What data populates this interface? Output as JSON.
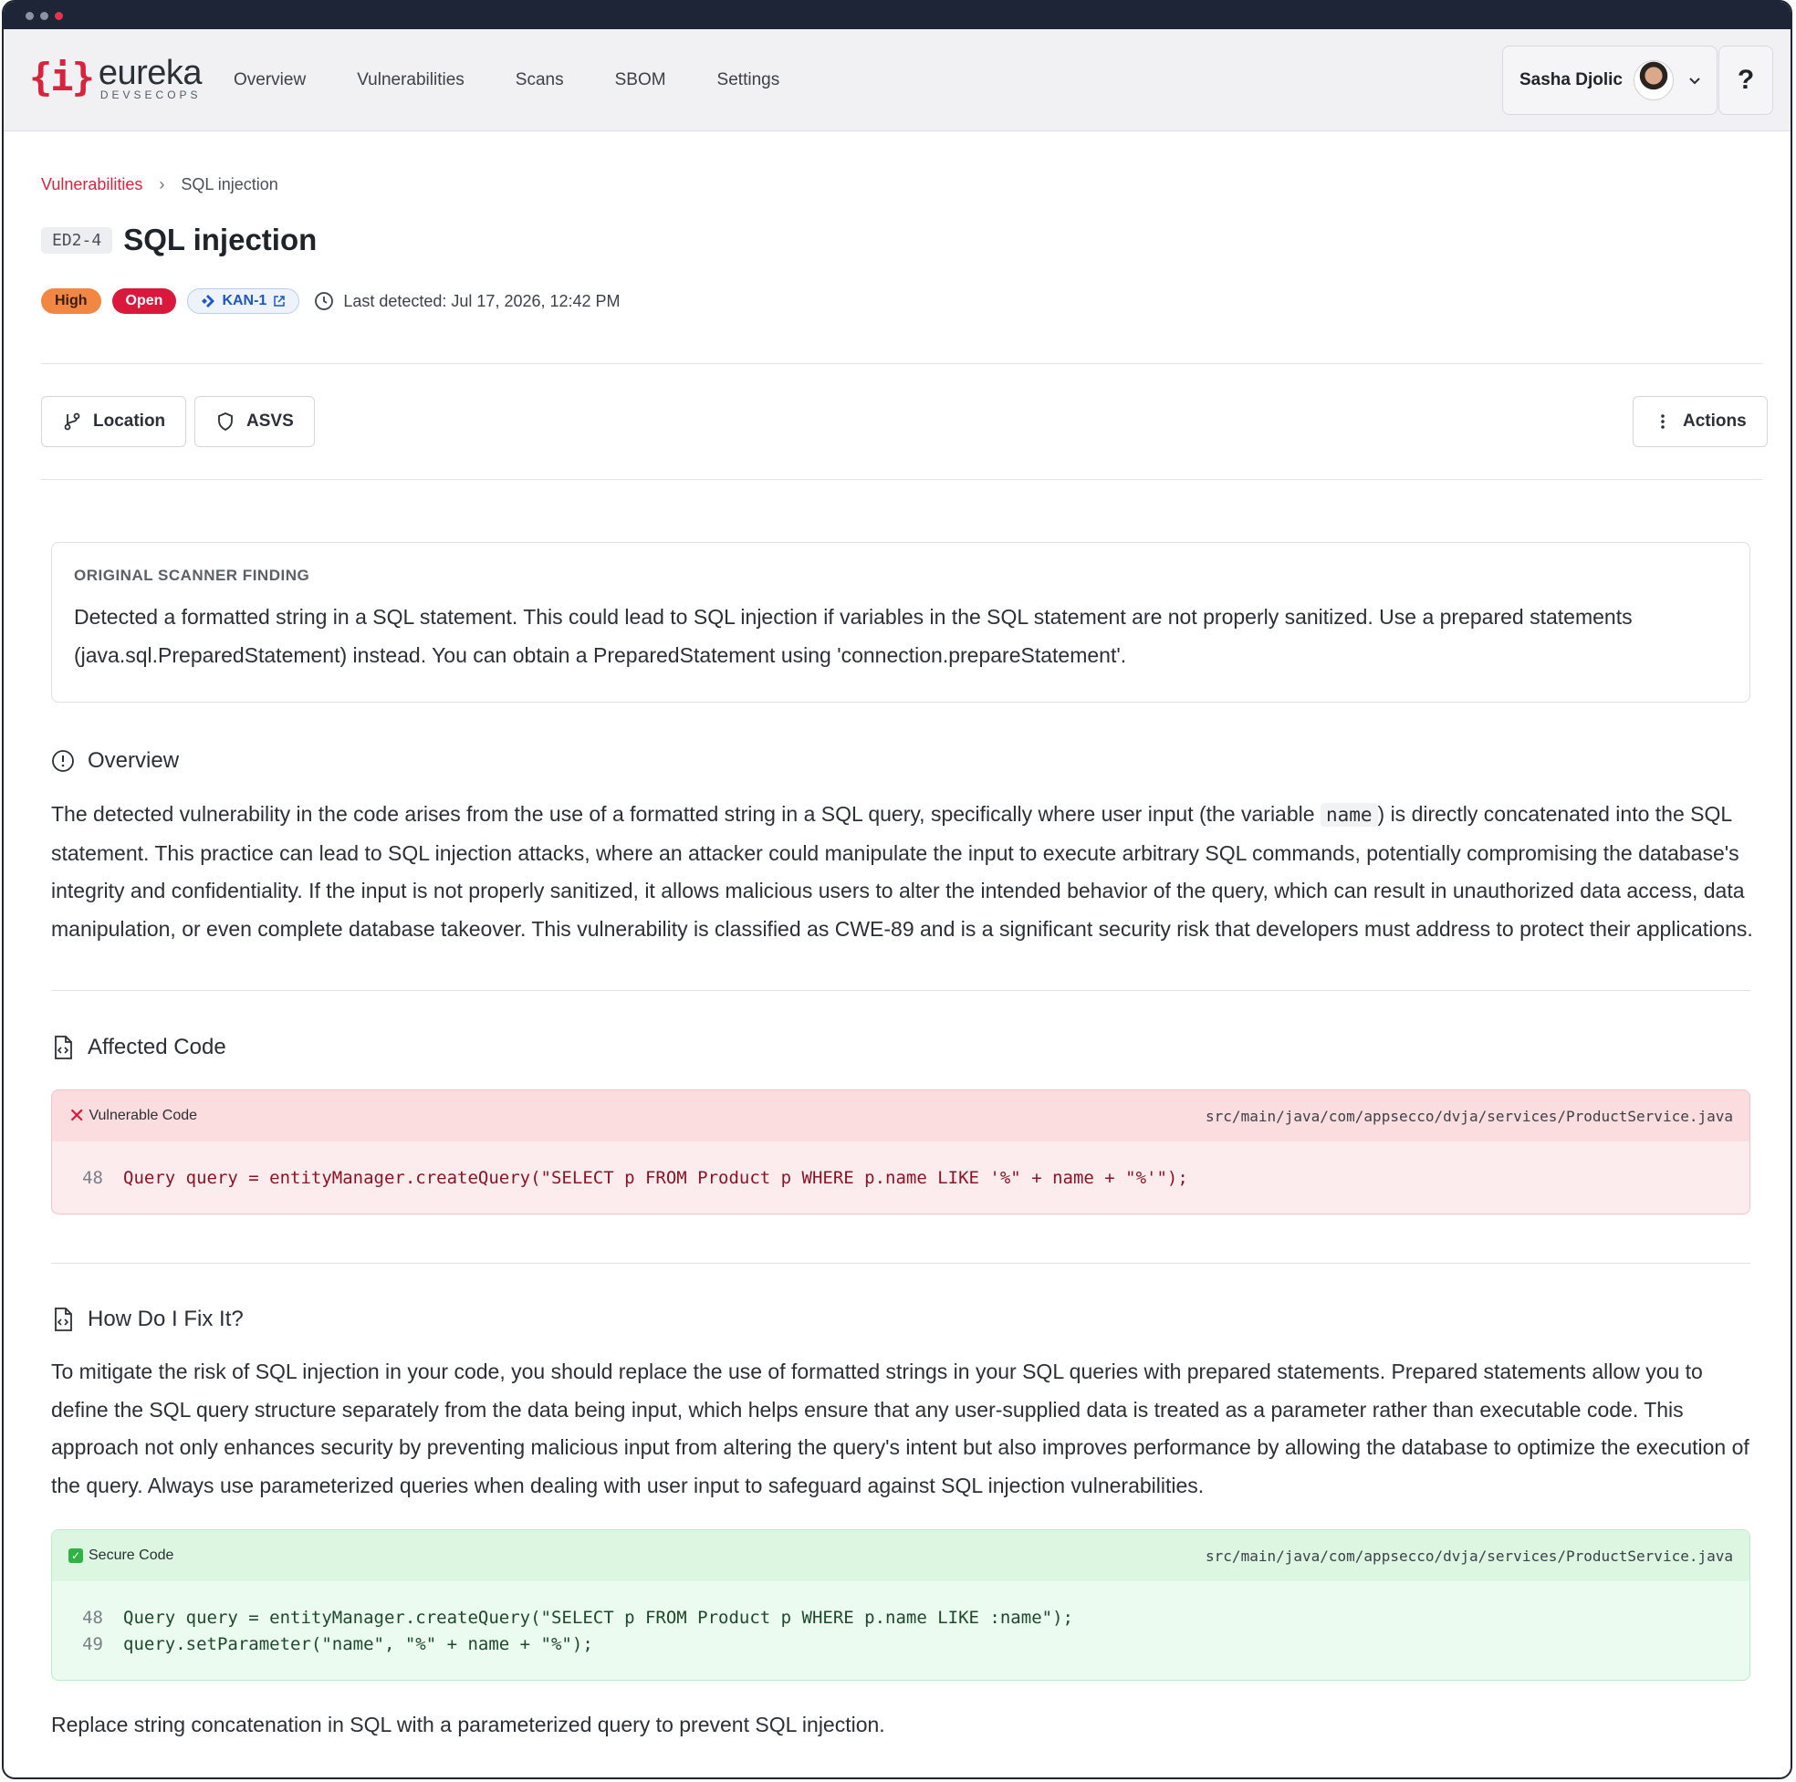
{
  "brand": {
    "mark": "{i}",
    "name": "eureka",
    "sub": "DEVSECOPS"
  },
  "nav": [
    "Overview",
    "Vulnerabilities",
    "Scans",
    "SBOM",
    "Settings"
  ],
  "user": {
    "name": "Sasha Djolic"
  },
  "help_label": "?",
  "breadcrumb": {
    "parent": "Vulnerabilities",
    "separator": "›",
    "current": "SQL injection"
  },
  "vuln": {
    "id": "ED2-4",
    "title": "SQL injection",
    "severity": "High",
    "status": "Open",
    "ticket": "KAN-1",
    "last_detected": "Last detected: Jul 17, 2026, 12:42 PM"
  },
  "buttons": {
    "location": "Location",
    "asvs": "ASVS",
    "actions": "Actions"
  },
  "finding": {
    "heading": "ORIGINAL SCANNER FINDING",
    "text": "Detected a formatted string in a SQL statement. This could lead to SQL injection if variables in the SQL statement are not properly sanitized. Use a prepared statements (java.sql.PreparedStatement) instead. You can obtain a PreparedStatement using 'connection.prepareStatement'."
  },
  "overview": {
    "heading": "Overview",
    "text_before": "The detected vulnerability in the code arises from the use of a formatted string in a SQL query, specifically where user input (the variable ",
    "code": "name",
    "text_after": ") is directly concatenated into the SQL statement. This practice can lead to SQL injection attacks, where an attacker could manipulate the input to execute arbitrary SQL commands, potentially compromising the database's integrity and confidentiality. If the input is not properly sanitized, it allows malicious users to alter the intended behavior of the query, which can result in unauthorized data access, data manipulation, or even complete database takeover. This vulnerability is classified as CWE-89 and is a significant security risk that developers must address to protect their applications."
  },
  "affected": {
    "heading": "Affected Code",
    "label": "Vulnerable Code",
    "path": "src/main/java/com/appsecco/dvja/services/ProductService.java",
    "lines": [
      {
        "n": "48",
        "code": "Query query = entityManager.createQuery(\"SELECT p FROM Product p WHERE p.name LIKE '%\" + name + \"%'\");"
      }
    ]
  },
  "fix": {
    "heading": "How Do I Fix It?",
    "text": "To mitigate the risk of SQL injection in your code, you should replace the use of formatted strings in your SQL queries with prepared statements. Prepared statements allow you to define the SQL query structure separately from the data being input, which helps ensure that any user-supplied data is treated as a parameter rather than executable code. This approach not only enhances security by preventing malicious input from altering the query's intent but also improves performance by allowing the database to optimize the execution of the query. Always use parameterized queries when dealing with user input to safeguard against SQL injection vulnerabilities.",
    "label": "Secure Code",
    "path": "src/main/java/com/appsecco/dvja/services/ProductService.java",
    "lines": [
      {
        "n": "48",
        "code": "Query query = entityManager.createQuery(\"SELECT p FROM Product p WHERE p.name LIKE :name\");"
      },
      {
        "n": "49",
        "code": "query.setParameter(\"name\", \"%\" + name + \"%\");"
      }
    ],
    "summary": "Replace string concatenation in SQL with a parameterized query to prevent SQL injection."
  },
  "colors": {
    "accent": "#d6243f",
    "high": "#f28744",
    "open": "#d9183b",
    "ticket": "#1d56c5"
  }
}
